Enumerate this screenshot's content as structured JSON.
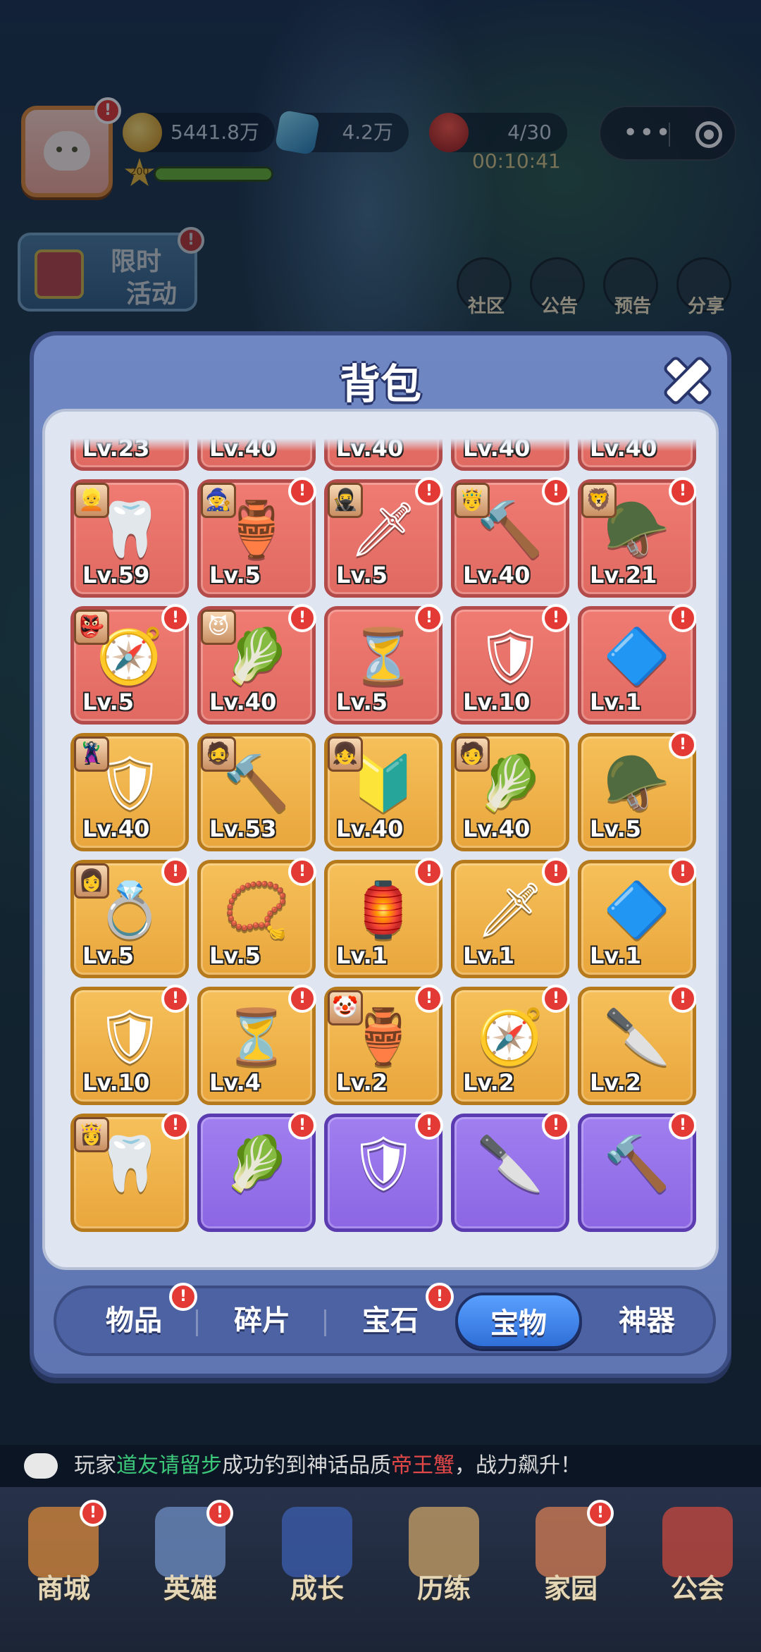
{
  "hud": {
    "gold": "5441.8万",
    "gems": "4.2万",
    "stamina": "4/30",
    "timer": "00:10:41",
    "level": "200",
    "dot": "!"
  },
  "event_banner": {
    "line1": "限时",
    "line2": "活动"
  },
  "side_icons": [
    {
      "label": "社区"
    },
    {
      "label": "公告"
    },
    {
      "label": "预告"
    },
    {
      "label": "分享"
    }
  ],
  "modal": {
    "title": "背包",
    "items": [
      {
        "icon": "🏮",
        "level": "Lv.23",
        "rarity": "red",
        "badge": false,
        "portrait": ""
      },
      {
        "icon": "💍",
        "level": "Lv.40",
        "rarity": "red",
        "badge": false,
        "portrait": ""
      },
      {
        "icon": "📿",
        "level": "Lv.40",
        "rarity": "red",
        "badge": false,
        "portrait": ""
      },
      {
        "icon": "🛡",
        "level": "Lv.40",
        "rarity": "red",
        "badge": false,
        "portrait": ""
      },
      {
        "icon": "🔰",
        "level": "Lv.40",
        "rarity": "red",
        "badge": false,
        "portrait": ""
      },
      {
        "icon": "🦷",
        "level": "Lv.59",
        "rarity": "red",
        "badge": false,
        "portrait": "👱"
      },
      {
        "icon": "🏺",
        "level": "Lv.5",
        "rarity": "red",
        "badge": true,
        "portrait": "🧙"
      },
      {
        "icon": "🗡",
        "level": "Lv.5",
        "rarity": "red",
        "badge": true,
        "portrait": "🥷"
      },
      {
        "icon": "🔨",
        "level": "Lv.40",
        "rarity": "red",
        "badge": true,
        "portrait": "🤴"
      },
      {
        "icon": "🪖",
        "level": "Lv.21",
        "rarity": "red",
        "badge": true,
        "portrait": "🦁"
      },
      {
        "icon": "🧭",
        "level": "Lv.5",
        "rarity": "red",
        "badge": true,
        "portrait": "👺"
      },
      {
        "icon": "🥬",
        "level": "Lv.40",
        "rarity": "red",
        "badge": true,
        "portrait": "😈"
      },
      {
        "icon": "⏳",
        "level": "Lv.5",
        "rarity": "red",
        "badge": true,
        "portrait": ""
      },
      {
        "icon": "🛡",
        "level": "Lv.10",
        "rarity": "red",
        "badge": true,
        "portrait": ""
      },
      {
        "icon": "🔷",
        "level": "Lv.1",
        "rarity": "red",
        "badge": true,
        "portrait": ""
      },
      {
        "icon": "🛡",
        "level": "Lv.40",
        "rarity": "gold",
        "badge": false,
        "portrait": "🦹"
      },
      {
        "icon": "🔨",
        "level": "Lv.53",
        "rarity": "gold",
        "badge": false,
        "portrait": "🧔"
      },
      {
        "icon": "🔰",
        "level": "Lv.40",
        "rarity": "gold",
        "badge": false,
        "portrait": "👧"
      },
      {
        "icon": "🥬",
        "level": "Lv.40",
        "rarity": "gold",
        "badge": false,
        "portrait": "🧑"
      },
      {
        "icon": "🪖",
        "level": "Lv.5",
        "rarity": "gold",
        "badge": true,
        "portrait": ""
      },
      {
        "icon": "💍",
        "level": "Lv.5",
        "rarity": "gold",
        "badge": true,
        "portrait": "👩"
      },
      {
        "icon": "📿",
        "level": "Lv.5",
        "rarity": "gold",
        "badge": true,
        "portrait": ""
      },
      {
        "icon": "🏮",
        "level": "Lv.1",
        "rarity": "gold",
        "badge": true,
        "portrait": ""
      },
      {
        "icon": "🗡",
        "level": "Lv.1",
        "rarity": "gold",
        "badge": true,
        "portrait": ""
      },
      {
        "icon": "🔷",
        "level": "Lv.1",
        "rarity": "gold",
        "badge": true,
        "portrait": ""
      },
      {
        "icon": "🛡",
        "level": "Lv.10",
        "rarity": "gold",
        "badge": true,
        "portrait": ""
      },
      {
        "icon": "⏳",
        "level": "Lv.4",
        "rarity": "gold",
        "badge": true,
        "portrait": ""
      },
      {
        "icon": "🏺",
        "level": "Lv.2",
        "rarity": "gold",
        "badge": true,
        "portrait": "🤡"
      },
      {
        "icon": "🧭",
        "level": "Lv.2",
        "rarity": "gold",
        "badge": true,
        "portrait": ""
      },
      {
        "icon": "🔪",
        "level": "Lv.2",
        "rarity": "gold",
        "badge": true,
        "portrait": ""
      },
      {
        "icon": "🦷",
        "level": "",
        "rarity": "gold",
        "badge": true,
        "portrait": "👸"
      },
      {
        "icon": "🥬",
        "level": "",
        "rarity": "purple",
        "badge": true,
        "portrait": ""
      },
      {
        "icon": "🛡",
        "level": "",
        "rarity": "purple",
        "badge": true,
        "portrait": ""
      },
      {
        "icon": "🔪",
        "level": "",
        "rarity": "purple",
        "badge": true,
        "portrait": ""
      },
      {
        "icon": "🔨",
        "level": "",
        "rarity": "purple",
        "badge": true,
        "portrait": ""
      }
    ],
    "tabs": [
      {
        "label": "物品",
        "badge": true,
        "active": false
      },
      {
        "label": "碎片",
        "badge": false,
        "active": false
      },
      {
        "label": "宝石",
        "badge": true,
        "active": false
      },
      {
        "label": "宝物",
        "badge": false,
        "active": true
      },
      {
        "label": "神器",
        "badge": false,
        "active": false
      }
    ]
  },
  "broadcast": {
    "prefix": "玩家",
    "player": "道友请留步",
    "middle": "成功钓到神话品质",
    "item": "帝王蟹",
    "suffix": "，战力飙升！"
  },
  "bottom_nav": [
    {
      "label": "商城",
      "badge": true
    },
    {
      "label": "英雄",
      "badge": true
    },
    {
      "label": "成长",
      "badge": false
    },
    {
      "label": "历练",
      "badge": false
    },
    {
      "label": "家园",
      "badge": true
    },
    {
      "label": "公会",
      "badge": false
    }
  ],
  "colors": {
    "rarity_red": "#e06a62",
    "rarity_gold": "#e9a63c",
    "rarity_purple": "#8c66e4",
    "modal_bg": "#6f87c3",
    "active_tab": "#2f6fd8",
    "badge_red": "#e43a35"
  }
}
